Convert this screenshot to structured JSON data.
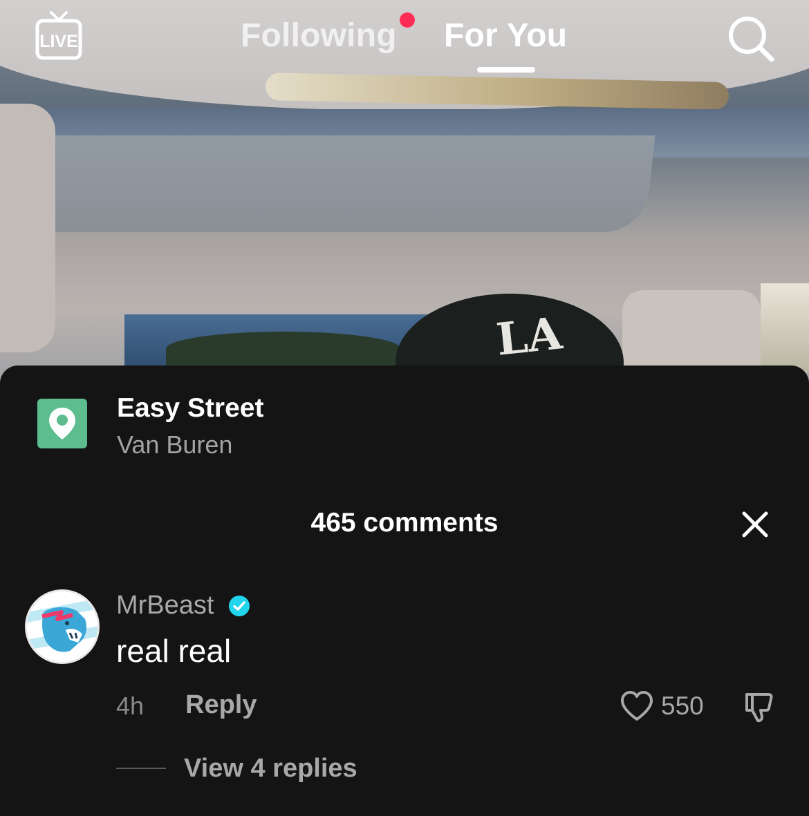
{
  "topnav": {
    "live_label": "LIVE",
    "following_label": "Following",
    "foryou_label": "For You",
    "active_tab": "For You",
    "notification_dot_color": "#fe2c55",
    "search_icon": "search-icon"
  },
  "location": {
    "title": "Easy Street",
    "subtitle": "Van Buren",
    "pin_color": "#5dbd8f",
    "icon": "location-pin-icon"
  },
  "comments": {
    "count_label": "465 comments",
    "close_icon": "close-icon",
    "items": [
      {
        "username": "MrBeast",
        "verified": true,
        "text": "real real",
        "time": "4h",
        "reply_label": "Reply",
        "likes": "550",
        "view_replies_label": "View 4 replies"
      }
    ]
  },
  "colors": {
    "sheet_bg": "#141414",
    "verified_badge": "#20d5ec",
    "secondary_text": "#a8a8a8"
  }
}
